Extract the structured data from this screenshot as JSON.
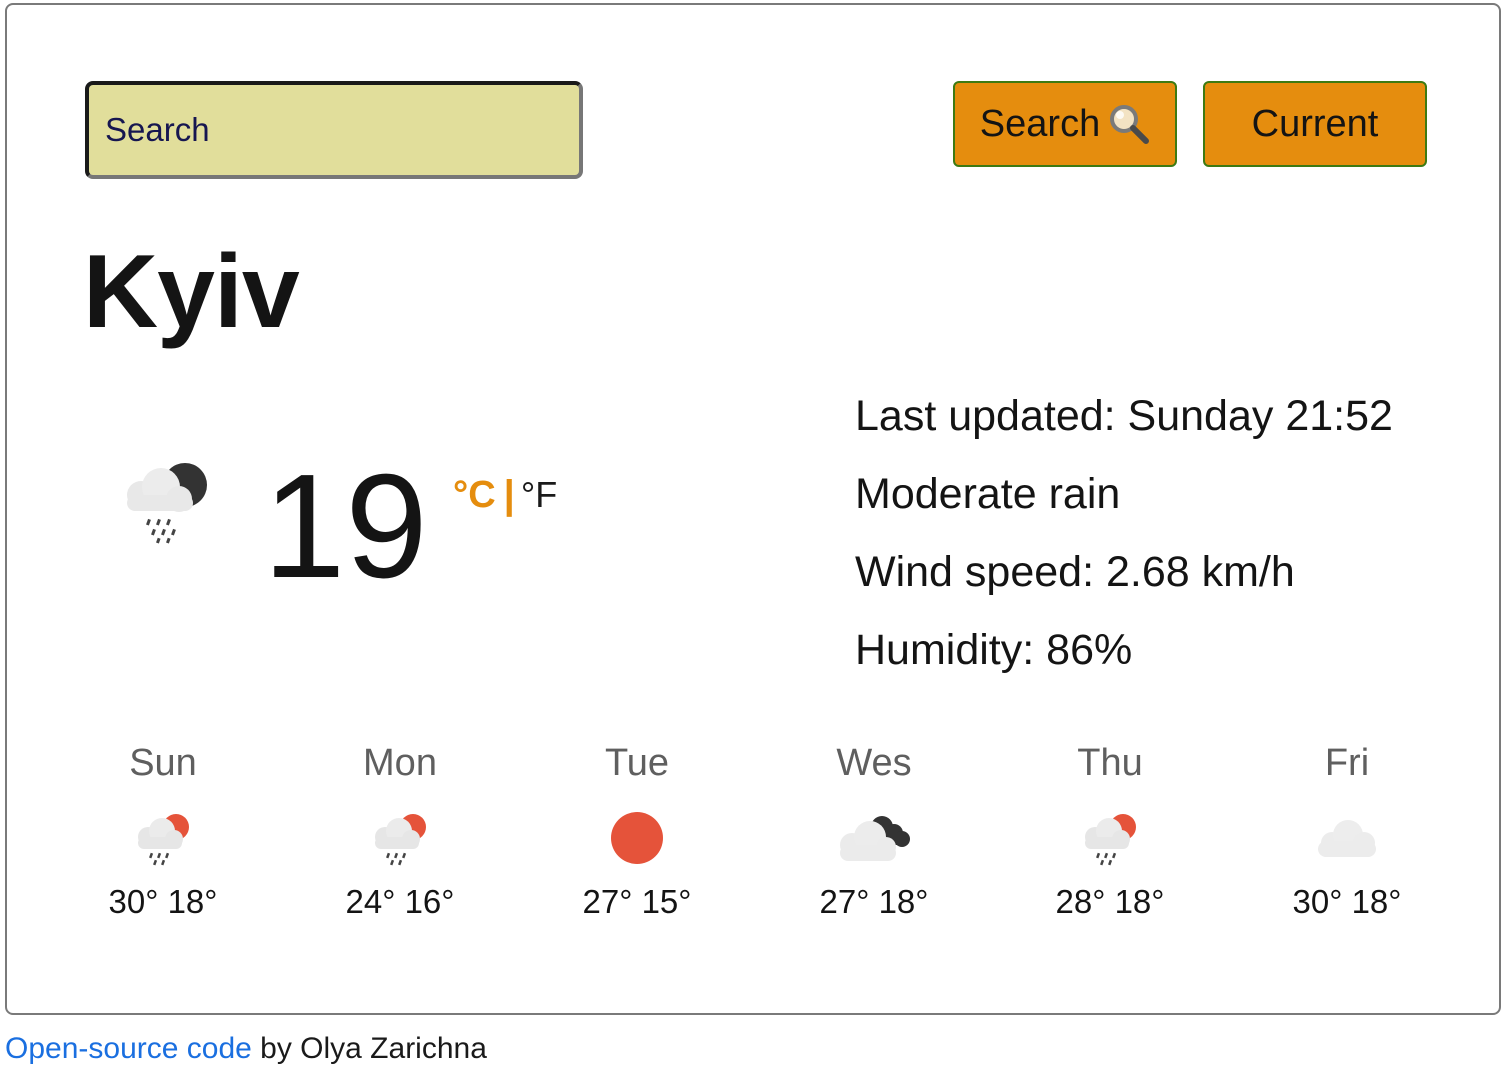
{
  "search": {
    "placeholder": "Search",
    "search_button_label": "Search",
    "current_button_label": "Current"
  },
  "city": "Kyiv",
  "current": {
    "temperature": "19",
    "unit_celsius": "°C",
    "unit_separator": "|",
    "unit_fahrenheit": "°F",
    "icon": "rain-night-icon",
    "last_updated": "Last updated: Sunday 21:52",
    "condition": "Moderate rain",
    "wind": "Wind speed: 2.68 km/h",
    "humidity": "Humidity: 86%"
  },
  "forecast": [
    {
      "day": "Sun",
      "temps": "30° 18°",
      "icon": "rain-sun-icon"
    },
    {
      "day": "Mon",
      "temps": "24° 16°",
      "icon": "rain-sun-icon"
    },
    {
      "day": "Tue",
      "temps": "27° 15°",
      "icon": "sun-icon"
    },
    {
      "day": "Wes",
      "temps": "27° 18°",
      "icon": "broken-clouds-icon"
    },
    {
      "day": "Thu",
      "temps": "28° 18°",
      "icon": "rain-sun-icon"
    },
    {
      "day": "Fri",
      "temps": "30° 18°",
      "icon": "cloud-icon"
    }
  ],
  "footer": {
    "link_text": "Open-source code",
    "suffix": " by Olya Zarichna"
  },
  "colors": {
    "accent_orange": "#e58d0e",
    "input_bg": "#e1de9b",
    "sun_red": "#e5533a",
    "link_blue": "#1a6fe0"
  }
}
